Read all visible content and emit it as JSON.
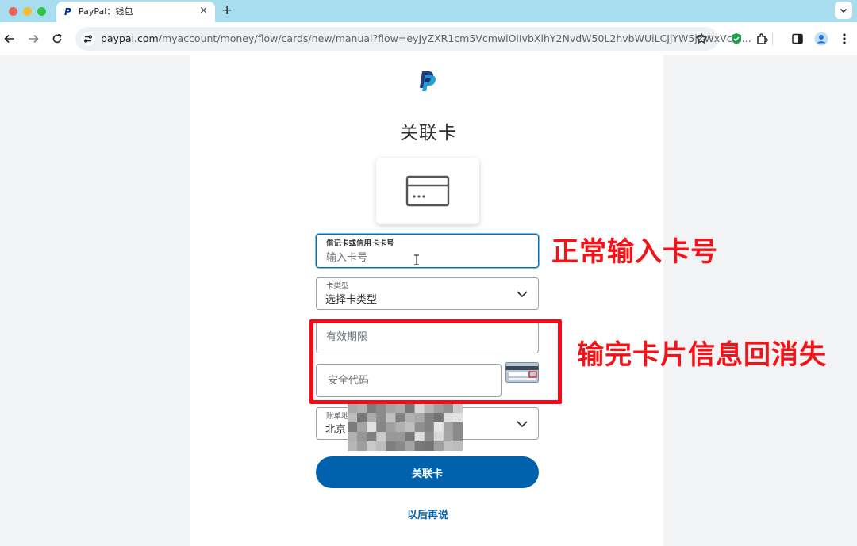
{
  "browser": {
    "tab_title": "PayPal：钱包",
    "tab_favicon": "P",
    "tab_close": "×",
    "new_tab": "+",
    "url_host": "paypal.com",
    "url_path": "/myaccount/money/flow/cards/new/manual?flow=eyJyZXR1cm5VcmwiOiIvbXlhY2NvdW50L2hvbWUiLCJjYW5jZWxVcm..."
  },
  "page": {
    "title": "关联卡",
    "card_number": {
      "label": "借记卡或信用卡卡号",
      "value": "输入卡号"
    },
    "card_type": {
      "label": "卡类型",
      "value": "选择卡类型"
    },
    "expiry": {
      "placeholder": "有效期限"
    },
    "security_code": {
      "placeholder": "安全代码"
    },
    "billing": {
      "label": "账单地",
      "value": "北京"
    },
    "submit_label": "关联卡",
    "later_label": "以后再说"
  },
  "annotations": {
    "note_1": "正常输入卡号",
    "note_2": "输完卡片信息回消失"
  },
  "colors": {
    "brand_blue": "#0062ad",
    "annotation_red": "#f21217"
  }
}
